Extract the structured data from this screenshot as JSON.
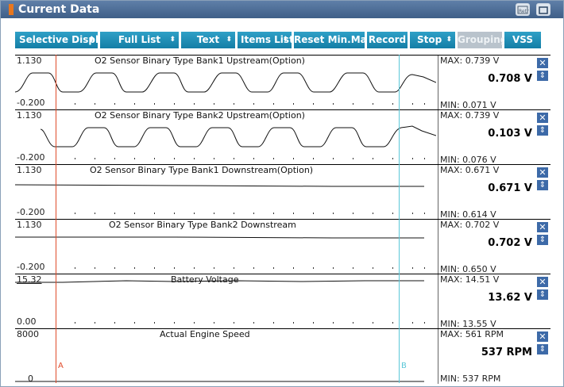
{
  "window": {
    "title": "Current Data"
  },
  "toolbar": {
    "buttons": [
      {
        "label": "Selective Display",
        "arrow": "⬍"
      },
      {
        "label": "Full List",
        "arrow": "⬍"
      },
      {
        "label": "Text",
        "arrow": "⬍"
      },
      {
        "label": "Items List",
        "arrow": "⬍"
      },
      {
        "label": "Reset Min.Max",
        "arrow": ""
      },
      {
        "label": "Record",
        "arrow": ""
      },
      {
        "label": "Stop",
        "arrow": "⬍"
      },
      {
        "label": "Grouping",
        "arrow": ""
      },
      {
        "label": "VSS",
        "arrow": ""
      }
    ]
  },
  "cursors": {
    "a": "A",
    "b": "B"
  },
  "sensors": [
    {
      "name": "O2 Sensor Binary Type Bank1 Upstream(Option)",
      "axis_max": "1.130",
      "axis_min": "-0.200",
      "max": "MAX: 0.739 V",
      "min": "MIN: 0.071 V",
      "value": "0.708 V"
    },
    {
      "name": "O2 Sensor Binary Type Bank2 Upstream(Option)",
      "axis_max": "1.130",
      "axis_min": "-0.200",
      "max": "MAX: 0.739 V",
      "min": "MIN: 0.076 V",
      "value": "0.103 V"
    },
    {
      "name": "O2 Sensor Binary Type Bank1 Downstream(Option)",
      "axis_max": "1.130",
      "axis_min": "-0.200",
      "max": "MAX: 0.671 V",
      "min": "MIN: 0.614 V",
      "value": "0.671 V"
    },
    {
      "name": "O2 Sensor Binary Type Bank2 Downstream",
      "axis_max": "1.130",
      "axis_min": "-0.200",
      "max": "MAX: 0.702 V",
      "min": "MIN: 0.650 V",
      "value": "0.702 V"
    },
    {
      "name": "Battery Voltage",
      "axis_max": "15.32",
      "axis_min": "0.00",
      "max": "MAX: 14.51 V",
      "min": "MIN: 13.55 V",
      "value": "13.62 V"
    },
    {
      "name": "Actual Engine Speed",
      "axis_max": "8000",
      "axis_min": "0",
      "max": "MAX:   561 RPM",
      "min": "MIN:   537 RPM",
      "value": "537 RPM"
    }
  ],
  "icons": {
    "close": "close-icon",
    "updown": "up-down-arrow-icon",
    "retry": "retry-icon",
    "window": "window-icon"
  }
}
